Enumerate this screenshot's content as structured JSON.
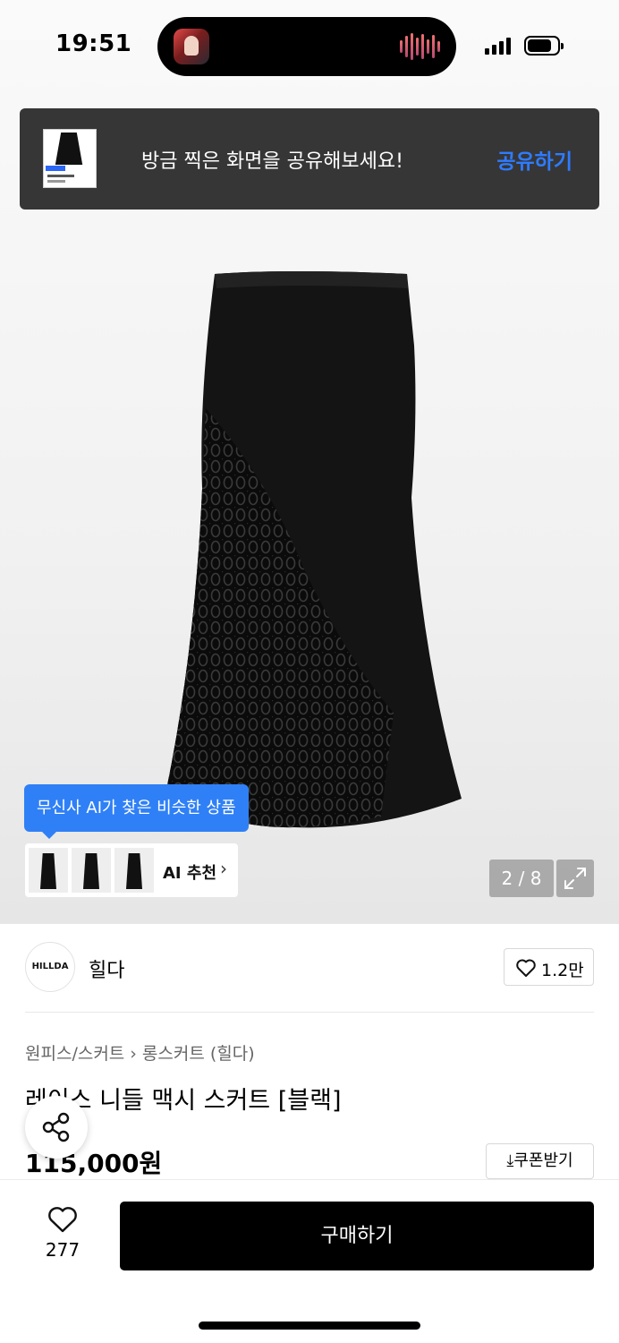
{
  "status_bar": {
    "time": "19:51"
  },
  "toast": {
    "message": "방금 찍은 화면을 공유해보세요!",
    "action_label": "공유하기",
    "accent_color": "#2f7bff"
  },
  "gallery": {
    "counter": "2 / 8"
  },
  "ai_recommend": {
    "tooltip": "무신사 AI가 찾은 비슷한 상품",
    "label": "AI 추천",
    "accent_color": "#2f80f6"
  },
  "brand": {
    "logo_text": "HILLDA",
    "name": "힐다",
    "like_count": "1.2만"
  },
  "product": {
    "breadcrumb": [
      "원피스/스커트",
      "롱스커트 (힐다)"
    ],
    "title": "레이스 니들 맥시 스커트 [블랙]",
    "price": "115,000원",
    "coupon_label": "쿠폰받기"
  },
  "bottom_bar": {
    "wish_count": "277",
    "buy_label": "구매하기"
  }
}
